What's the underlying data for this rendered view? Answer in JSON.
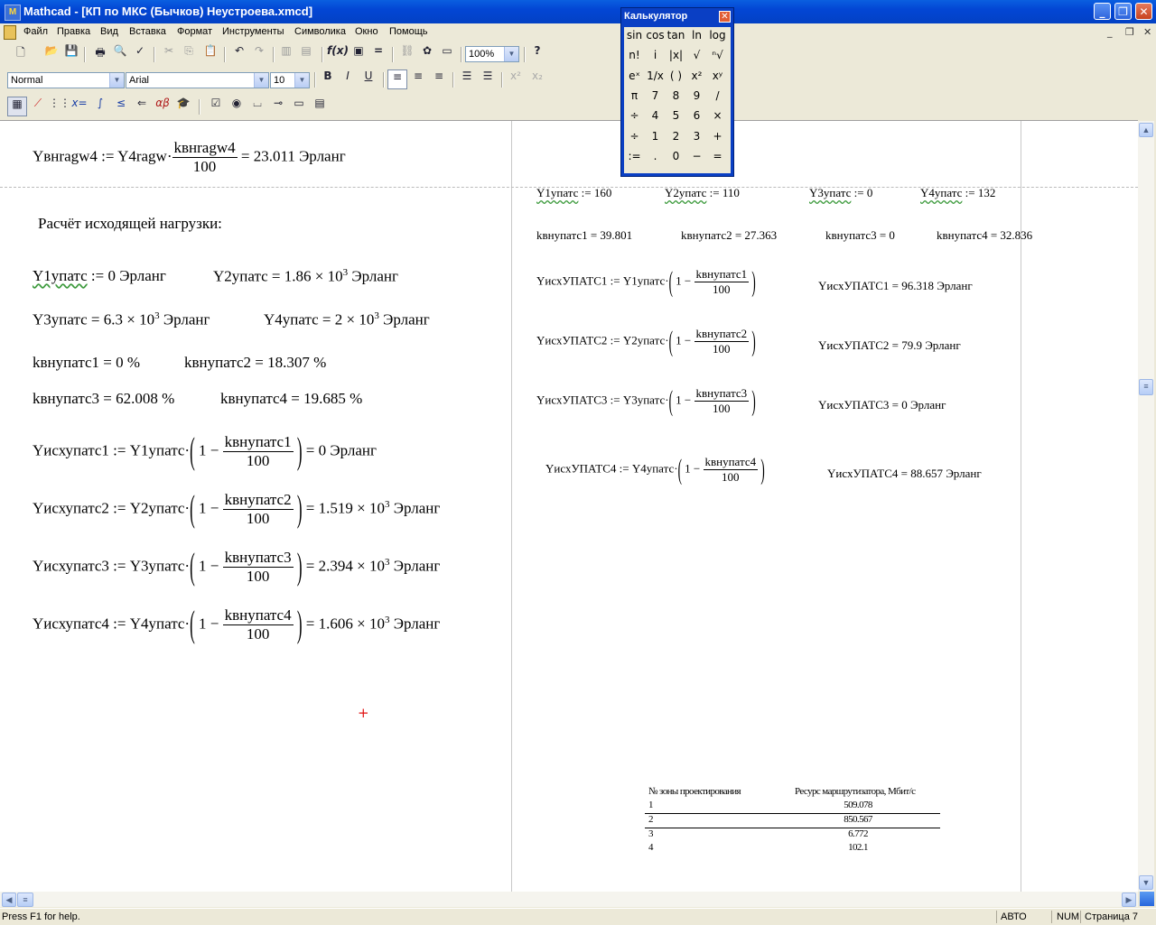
{
  "window": {
    "title": "Mathcad - [КП по МКС (Бычков) Неустроева.xmcd]",
    "min": "_",
    "max": "❐",
    "close": "✕"
  },
  "menu": [
    "Файл",
    "Правка",
    "Вид",
    "Вставка",
    "Формат",
    "Инструменты",
    "Символика",
    "Окно",
    "Помощь"
  ],
  "toolbar": {
    "zoom": "100%",
    "style": "Normal",
    "font": "Arial",
    "size": "10"
  },
  "calculator": {
    "title": "Калькулятор",
    "close": "✕",
    "keys": [
      [
        "sin",
        "cos",
        "tan",
        "ln",
        "log"
      ],
      [
        "n!",
        "i",
        "|x|",
        "√",
        "ⁿ√"
      ],
      [
        "eˣ",
        "1/x",
        "( )",
        "x²",
        "xʸ"
      ],
      [
        "π",
        "7",
        "8",
        "9",
        "/"
      ],
      [
        "÷",
        "4",
        "5",
        "6",
        "×"
      ],
      [
        "÷",
        "1",
        "2",
        "3",
        "+"
      ],
      [
        ":=",
        ".",
        "0",
        "−",
        "="
      ]
    ]
  },
  "left": {
    "f1": {
      "lhs": "Yвнragw4 := Y4ragw·",
      "num": "kвнragw4",
      "den": "100",
      "rhs": "= 23.011  Эрланг"
    },
    "heading": "Расчёт исходящей нагрузки:",
    "l1a": "Y1упатс",
    "l1b": " := 0   Эрланг",
    "l1c": "Y2упатс = 1.86 × 10",
    "l1c_exp": "3",
    "l1d": " Эрланг",
    "l2a": "Y3упатс = 6.3 × 10",
    "l2a_exp": "3",
    "l2b": "   Эрланг",
    "l2c": "Y4упатс = 2 × 10",
    "l2c_exp": "3",
    "l2d": " Эрланг",
    "k1": "kвнупатс1 = 0  %",
    "k2": "kвнупатс2 = 18.307  %",
    "k3": "kвнупатс3 = 62.008  %",
    "k4": "kвнупатс4 = 19.685  %",
    "e1": {
      "lhs": "Yисхупатс1 := Y1упатс·",
      "num": "kвнупатс1",
      "den": "100",
      "rhs": "= 0   Эрланг",
      "exp": ""
    },
    "e2": {
      "lhs": "Yисхупатс2 := Y2упатс·",
      "num": "kвнупатс2",
      "den": "100",
      "rhs": "= 1.519 × 10",
      "exp": "3",
      "unit": "  Эрланг"
    },
    "e3": {
      "lhs": "Yисхупатс3 := Y3упатс·",
      "num": "kвнупатс3",
      "den": "100",
      "rhs": "= 2.394 × 10",
      "exp": "3",
      "unit": "  Эрланг"
    },
    "e4": {
      "lhs": "Yисхупатс4 := Y4упатс·",
      "num": "kвнупатс4",
      "den": "100",
      "rhs": "= 1.606 × 10",
      "exp": "3",
      "unit": "  Эрланг"
    },
    "one_minus": "1 −"
  },
  "right": {
    "y1": "Y1упатс",
    "y1v": " := 160",
    "y2": "Y2упатс",
    "y2v": " := 110",
    "y3": "Y3упатс",
    "y3v": " := 0",
    "y4": "Y4упатс",
    "y4v": " := 132",
    "kv1": "kвнупатс1 = 39.801",
    "kv2": "kвнупатс2 = 27.363",
    "kv3": "kвнупатс3 = 0",
    "kv4": "kвнупатс4 = 32.836",
    "r1": {
      "lhs": "YисхУПАТС1 := Y1упатс·",
      "num": "kвнупатс1",
      "den": "100",
      "res": "YисхУПАТС1 = 96.318 Эрланг"
    },
    "r2": {
      "lhs": "YисхУПАТС2 := Y2упатс·",
      "num": "kвнупатс2",
      "den": "100",
      "res": "YисхУПАТС2 = 79.9     Эрланг"
    },
    "r3": {
      "lhs": "YисхУПАТС3 := Y3упатс·",
      "num": "kвнупатс3",
      "den": "100",
      "res": "YисхУПАТС3 = 0          Эрланг"
    },
    "r4": {
      "lhs": "YисхУПАТС4 := Y4упатс·",
      "num": "kвнупатс4",
      "den": "100",
      "res": "YисхУПАТС4 = 88.657 Эрланг"
    },
    "one_minus": "1 −"
  },
  "table": {
    "headers": [
      "№ зоны проектирования",
      "Ресурс маршрутизатора, Мбит/с"
    ],
    "rows": [
      [
        "1",
        "509.078"
      ],
      [
        "2",
        "850.567"
      ],
      [
        "3",
        "6.772"
      ],
      [
        "4",
        "102.1"
      ]
    ]
  },
  "status": {
    "help": "Press F1 for help.",
    "auto": "АВТО",
    "num": "NUM",
    "page": "Страница 7"
  }
}
